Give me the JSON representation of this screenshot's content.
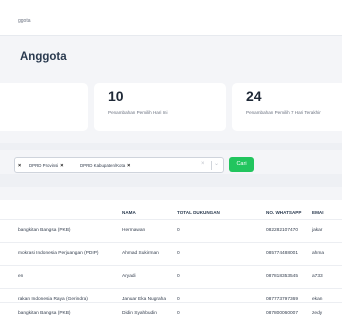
{
  "breadcrumb": "ggota",
  "page_title": "Anggota",
  "cards": [
    {
      "value": "",
      "label": ""
    },
    {
      "value": "10",
      "label": "Penambahan Pemilih Hari Ini"
    },
    {
      "value": "24",
      "label": "Penambahan Pemilih 7 Hari Terakhir"
    }
  ],
  "filter": {
    "chips": [
      {
        "label": ""
      },
      {
        "label": "DPRD Provinsi"
      },
      {
        "label": "DPRD Kabupaten/Kota"
      }
    ],
    "clear_symbol": "×",
    "dropdown_symbol": "⌄",
    "search_button": "Cari"
  },
  "table": {
    "headers": [
      "",
      "NAMA",
      "TOTAL DUKUNGAN",
      "NO. WHATSAPP",
      "EMAI"
    ],
    "rows": [
      {
        "party": "bangkitan Bangsa (PKB)",
        "name": "Hermawan",
        "total": "0",
        "wa": "082282107470",
        "email": "jakar"
      },
      {
        "party": "mokrasi Indonesia Perjuangan (PDIP)",
        "name": "Ahmad Sukirman",
        "total": "0",
        "wa": "085774488001",
        "email": "ahma"
      },
      {
        "party": "en",
        "name": "Aryadi",
        "total": "0",
        "wa": "087818353545",
        "email": "a733"
      },
      {
        "party": "rakan Indonesia Raya (Gerindra)",
        "name": "Januar Eka Nugraha",
        "total": "0",
        "wa": "087773797369",
        "email": "ekan"
      },
      {
        "party": "bangkitan Bangsa (PKB)",
        "name": "Didin Syahbudin",
        "total": "0",
        "wa": "087800060007",
        "email": "zedy"
      }
    ]
  },
  "colors": {
    "accent": "#22c55e",
    "title": "#2a3a4f",
    "background": "#f4f5f8"
  }
}
